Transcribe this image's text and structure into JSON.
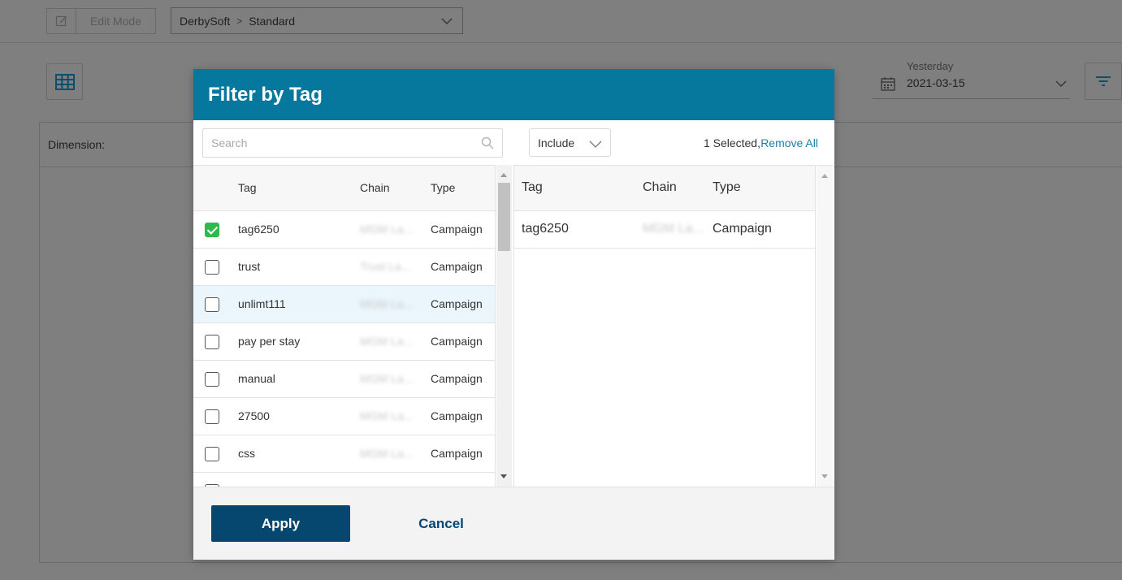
{
  "background": {
    "edit_mode_label": "Edit Mode",
    "breadcrumb": {
      "org": "DerbySoft",
      "separator": ">",
      "view": "Standard"
    },
    "date": {
      "caption": "Yesterday",
      "value": "2021-03-15"
    },
    "dimension_label": "Dimension:"
  },
  "modal": {
    "title": "Filter by Tag",
    "search": {
      "placeholder": "Search",
      "value": ""
    },
    "left_table": {
      "headers": {
        "tag": "Tag",
        "chain": "Chain",
        "type": "Type"
      },
      "rows": [
        {
          "checked": true,
          "tag": "tag6250",
          "chain": "MGM La...",
          "type": "Campaign"
        },
        {
          "checked": false,
          "tag": "trust",
          "chain": "Trust La...",
          "type": "Campaign"
        },
        {
          "checked": false,
          "tag": "unlimt111",
          "chain": "MGM La...",
          "type": "Campaign"
        },
        {
          "checked": false,
          "tag": "pay per stay",
          "chain": "MGM La...",
          "type": "Campaign"
        },
        {
          "checked": false,
          "tag": "manual",
          "chain": "MGM La...",
          "type": "Campaign"
        },
        {
          "checked": false,
          "tag": "27500",
          "chain": "MGM La...",
          "type": "Campaign"
        },
        {
          "checked": false,
          "tag": "css",
          "chain": "MGM La...",
          "type": "Campaign"
        }
      ]
    },
    "include_select": {
      "value": "Include"
    },
    "selected_count": "1 Selected,",
    "remove_all_label": "Remove All",
    "right_table": {
      "headers": {
        "tag": "Tag",
        "chain": "Chain",
        "type": "Type"
      },
      "rows": [
        {
          "tag": "tag6250",
          "chain": "MGM La...",
          "type": "Campaign"
        }
      ]
    },
    "footer": {
      "apply_label": "Apply",
      "cancel_label": "Cancel"
    }
  },
  "colors": {
    "header": "#06789d",
    "primary_button": "#064770",
    "link": "#1a7fa8",
    "check": "#2dbb4c",
    "overlay": "#7f7f7f"
  }
}
